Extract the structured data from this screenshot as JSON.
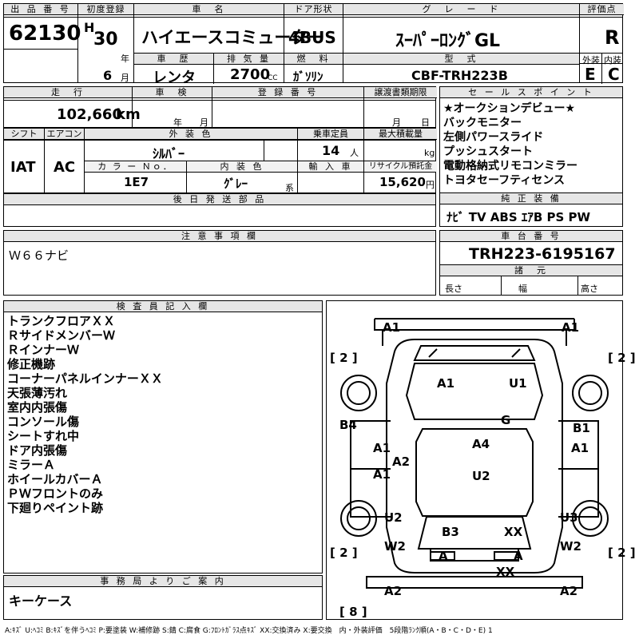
{
  "header": {
    "lot_label": "出 品 番 号",
    "lot_number": "62130",
    "first_reg_label": "初度登録",
    "era": "H",
    "year": "30",
    "year_unit": "年",
    "month": "6",
    "month_unit": "月",
    "name_label": "車　名",
    "car_name": "ハイエースコミューター",
    "history_label": "車　歴",
    "history": "レンタ",
    "displacement_label": "排 気 量",
    "displacement": "2700",
    "cc": "CC",
    "door_label": "ドア形状",
    "door": "4BUS",
    "fuel_label": "燃　料",
    "fuel": "ｶﾞｿﾘﾝ",
    "grade_label": "グ　レ　ー　ド",
    "grade": "ｽｰﾊﾟｰﾛﾝｸﾞGL",
    "model_label": "型　式",
    "model": "CBF-TRH223B",
    "eval_label": "評価点",
    "eval": "R",
    "ext_label": "外装",
    "ext": "E",
    "int_label": "内装",
    "int": "C"
  },
  "row2": {
    "mileage_label": "走　行",
    "mileage": "102,660",
    "km": "km",
    "inspection_label": "車　検",
    "insp_year": "年",
    "insp_month": "月",
    "plate_label": "登 録 番 号",
    "transfer_label": "譲渡書類期限",
    "tr_month": "月",
    "tr_day": "日"
  },
  "specs": {
    "shift_label": "シフト",
    "shift": "IAT",
    "ac_label": "エアコン",
    "ac": "AC",
    "color_label": "外 装 色",
    "color": "ｼﾙﾊﾞｰ",
    "capacity_label": "乗車定員",
    "capacity": "14",
    "capacity_unit": "人",
    "load_label": "最大積載量",
    "load_unit": "kg",
    "color_no_label": "カ ラ ー Ｎｏ．",
    "color_no": "1E7",
    "interior_label": "内 装 色",
    "interior": "ｸﾞﾚｰ",
    "interior_unit": "系",
    "import_label": "輸 入 車",
    "recycle_label": "リサイクル預託金",
    "recycle": "15,620",
    "recycle_unit": "円"
  },
  "later_label": "後 日 発 送 部 品",
  "sales": {
    "label": "セ ー ル ス ポ イ ン ト",
    "items": [
      "★オークションデビュー★",
      "バックモニター",
      "左側パワースライド",
      "プッシュスタート",
      "電動格納式リモコンミラー",
      "トヨタセーフティセンス"
    ]
  },
  "equipment": {
    "label": "純 正 装 備",
    "value": "ﾅﾋﾞ TV ABS ｴｱB PS PW"
  },
  "notes": {
    "label": "注 意 事 項 欄",
    "value": "Ｗ６６ナビ"
  },
  "chassis": {
    "label": "車 台 番 号",
    "value": "TRH223-6195167",
    "dims_label": "諸　元",
    "length": "長さ",
    "width": "幅",
    "height": "高さ"
  },
  "inspector": {
    "label": "検 査 員 記 入 欄",
    "items": [
      "トランクフロアＸＸ",
      "ＲサイドメンバーＷ",
      "ＲインナーＷ",
      "修正機跡",
      "コーナーパネルインナーＸＸ",
      "天張薄汚れ",
      "室内内張傷",
      "コンソール傷",
      "シートすれ中",
      "ドア内張傷",
      "ミラーＡ",
      "ホイールカバーＡ",
      "ＰＷフロントのみ",
      "下廻りペイント跡"
    ]
  },
  "office": {
    "label": "事 務 局 よ り ご 案 内",
    "value": "キーケース"
  },
  "legend": "A:ｷｽﾞ U:ﾍｺﾐ B:ｷｽﾞを伴うﾍｺﾐ P:要塗装 W:補修跡 S:錆 C:腐食 G:ﾌﾛﾝﾄｶﾞﾗｽ点ｷｽﾞ XX:交換済み X:要交換　内・外装評価　5段階ﾗﾝｸ順(A・B・C・D・E) 1",
  "diagram": {
    "tl": "A1",
    "tr": "A1",
    "l2": "[ 2 ]",
    "r2": "[ 2 ]",
    "hood_l": "A1",
    "hood_r": "U1",
    "glass": "G",
    "b4": "B4",
    "b1": "B1",
    "ld1": "A1",
    "ld2": "A2",
    "ld3": "A1",
    "rd1": "A1",
    "roof1": "A4",
    "roof2": "U2",
    "u2l": "U2",
    "u3r": "U3",
    "w2l": "W2",
    "w2r": "W2",
    "b3": "B3",
    "xx1": "XX",
    "bl": "[ 2 ]",
    "br": "[ 2 ]",
    "ta": "A",
    "tb": "A",
    "xx2": "XX",
    "a2l": "A2",
    "a2r": "A2",
    "b8": "[ 8 ]"
  }
}
